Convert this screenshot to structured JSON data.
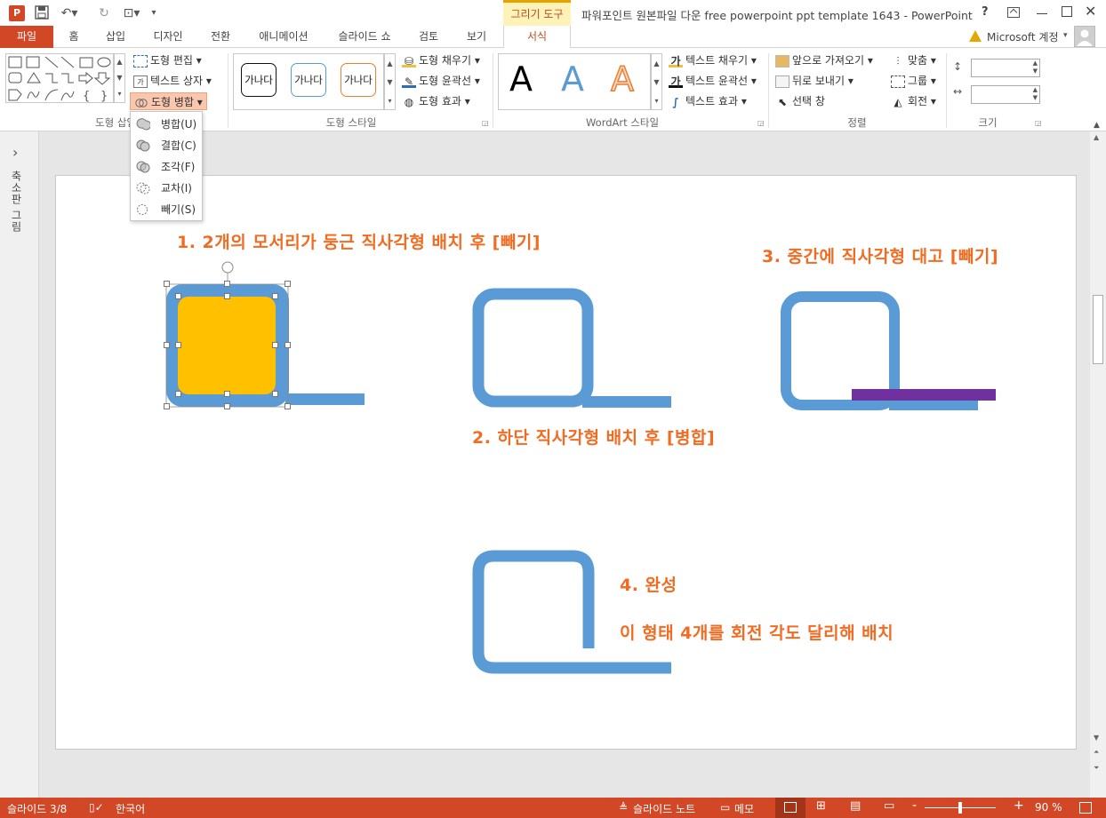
{
  "window": {
    "title": "파워포인트 원본파일 다운 free powerpoint ppt template 1643 - PowerPoint",
    "contextual_tab_group": "그리기 도구",
    "help": "?"
  },
  "account": {
    "label": "Microsoft 계정"
  },
  "tabs": [
    {
      "label": "파일"
    },
    {
      "label": "홈"
    },
    {
      "label": "삽입"
    },
    {
      "label": "디자인"
    },
    {
      "label": "전환"
    },
    {
      "label": "애니메이션"
    },
    {
      "label": "슬라이드 쇼"
    },
    {
      "label": "검토"
    },
    {
      "label": "보기"
    },
    {
      "label": "서식"
    }
  ],
  "ribbon": {
    "insert_shapes": {
      "label": "도형 삽입",
      "edit_shape": "도형 편집",
      "text_box": "텍스트 상자",
      "merge_shapes": "도형 병합"
    },
    "shape_styles": {
      "label": "도형 스타일",
      "preset_text": "가나다",
      "fill": "도형 채우기",
      "outline": "도형 윤곽선",
      "effects": "도형 효과"
    },
    "wordart": {
      "label": "WordArt 스타일",
      "letter": "A",
      "text_fill": "텍스트 채우기",
      "text_outline": "텍스트 윤곽선",
      "text_effects": "텍스트 효과",
      "fill_glyph": "가",
      "outline_glyph": "가"
    },
    "arrange": {
      "label": "정렬",
      "bring_forward": "앞으로 가져오기",
      "send_backward": "뒤로 보내기",
      "selection_pane": "선택 창",
      "align": "맞춤",
      "group": "그룹",
      "rotate": "회전"
    },
    "size": {
      "label": "크기"
    }
  },
  "merge_menu": [
    {
      "label": "병합(U)"
    },
    {
      "label": "결합(C)"
    },
    {
      "label": "조각(F)"
    },
    {
      "label": "교차(I)"
    },
    {
      "label": "빼기(S)"
    }
  ],
  "thumbnail_pane": {
    "label": "축소판 그림",
    "chevron": "›"
  },
  "slide": {
    "step1": "1. 2개의 모서리가 둥근 직사각형 배치 후 [빼기]",
    "step2": "2. 하단 직사각형 배치 후 [병합]",
    "step3": "3. 중간에 직사각형 대고 [빼기]",
    "step4": "4. 완성",
    "step4_note": "이 형태 4개를 회전 각도 달리해 배치"
  },
  "statusbar": {
    "slide_counter": "슬라이드 3/8",
    "language": "한국어",
    "notes": "슬라이드 노트",
    "comments": "메모",
    "zoom_minus": "-",
    "zoom_plus": "+",
    "zoom": "90 %"
  },
  "colors": {
    "accent": "#d24726",
    "shape_blue": "#5b9bd5",
    "shape_orange": "#ffc000",
    "shape_purple": "#7030a0",
    "instruction_orange": "#f26b21",
    "contextual_tab": "#fdf2b7"
  }
}
